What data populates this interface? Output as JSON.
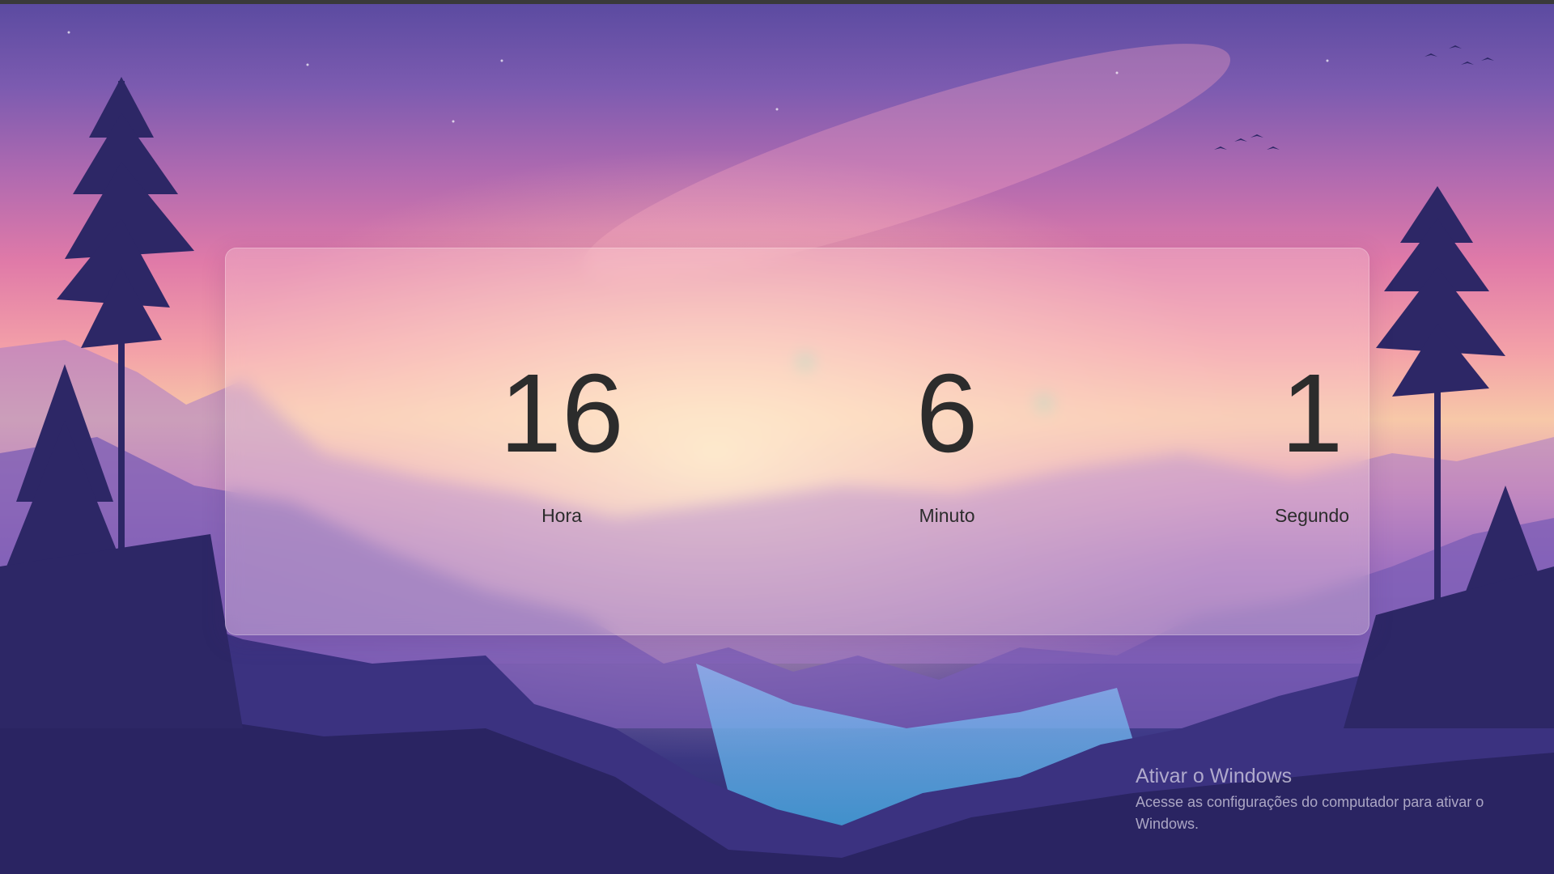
{
  "clock": {
    "hour": {
      "value": "16",
      "label": "Hora"
    },
    "minute": {
      "value": "6",
      "label": "Minuto"
    },
    "second": {
      "value": "1",
      "label": "Segundo"
    }
  },
  "watermark": {
    "title": "Ativar o Windows",
    "subtitle_line1": "Acesse as configurações do computador para ativar o",
    "subtitle_line2": "Windows."
  },
  "colors": {
    "sky_top": "#5a4aa0",
    "sky_glow": "#f7c8a8",
    "silhouette": "#2d2766",
    "panel_text": "#2c2c2c"
  }
}
